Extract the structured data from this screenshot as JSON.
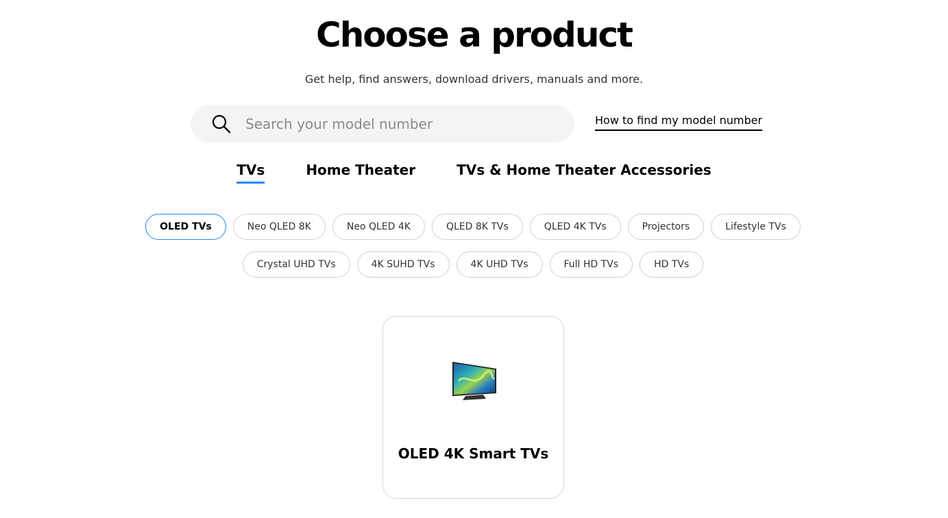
{
  "header": {
    "title": "Choose a product",
    "subtitle": "Get help, find answers, download drivers, manuals and more."
  },
  "search": {
    "placeholder": "Search your model number",
    "value": "",
    "help_link": "How to find my model number"
  },
  "tabs": [
    {
      "label": "TVs",
      "active": true
    },
    {
      "label": "Home Theater",
      "active": false
    },
    {
      "label": "TVs & Home Theater Accessories",
      "active": false
    }
  ],
  "categories": [
    {
      "label": "OLED TVs",
      "active": true
    },
    {
      "label": "Neo QLED 8K"
    },
    {
      "label": "Neo QLED 4K"
    },
    {
      "label": "QLED 8K TVs"
    },
    {
      "label": "QLED 4K TVs"
    },
    {
      "label": "Projectors"
    },
    {
      "label": "Lifestyle TVs"
    },
    {
      "label": "Crystal UHD TVs"
    },
    {
      "label": "4K SUHD TVs"
    },
    {
      "label": "4K UHD TVs"
    },
    {
      "label": "Full HD TVs"
    },
    {
      "label": "HD TVs"
    }
  ],
  "products": [
    {
      "label": "OLED 4K Smart TVs",
      "icon": "oled-tv-image"
    }
  ],
  "colors": {
    "accent": "#2189ff",
    "search_bg": "#f4f4f4",
    "chip_border": "#d0d0d0"
  }
}
